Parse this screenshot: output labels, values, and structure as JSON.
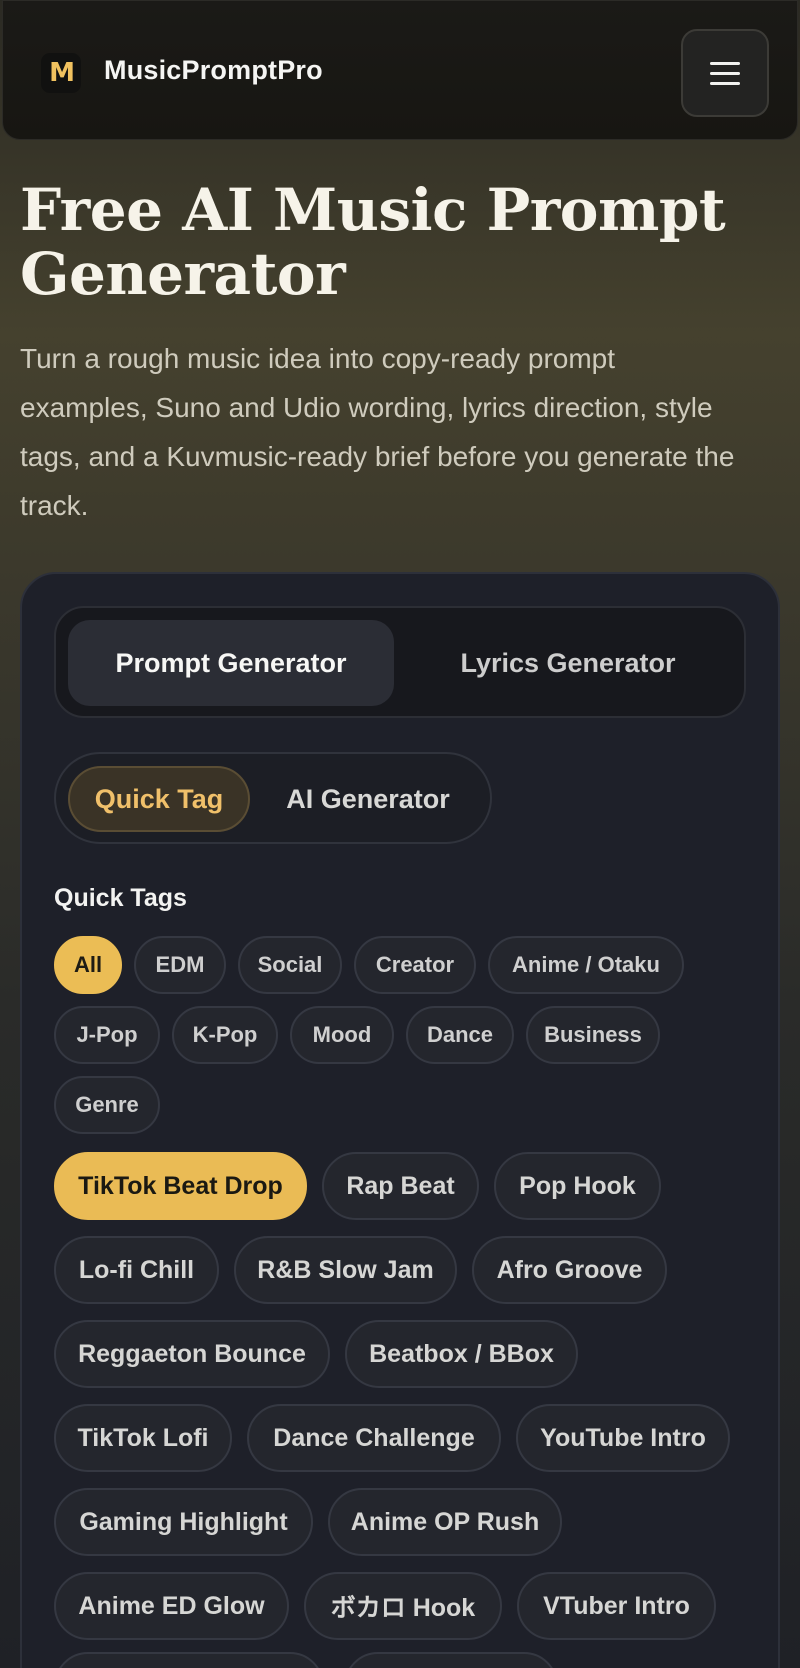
{
  "header": {
    "logo_text": "M",
    "brand": "MusicPromptPro",
    "menu_icon": "hamburger-icon"
  },
  "hero": {
    "title": "Free AI Music Prompt Generator",
    "subtitle": "Turn a rough music idea into copy-ready prompt examples, Suno and Udio wording, lyrics direction, style tags, and a Kuvmusic-ready brief before you generate the track."
  },
  "tabs": {
    "active": "Prompt Generator",
    "inactive": "Lyrics Generator"
  },
  "mode": {
    "active": "Quick Tag",
    "inactive": "AI Generator"
  },
  "quick_tags_label": "Quick Tags",
  "categories": [
    "All",
    "EDM",
    "Social",
    "Creator",
    "Anime / Otaku",
    "J-Pop",
    "K-Pop",
    "Mood",
    "Dance",
    "Business",
    "Genre"
  ],
  "selected_category": "All",
  "tags": [
    "TikTok Beat Drop",
    "Rap Beat",
    "Pop Hook",
    "Lo-fi Chill",
    "R&B Slow Jam",
    "Afro Groove",
    "Reggaeton Bounce",
    "Beatbox / BBox",
    "TikTok Lofi",
    "Dance Challenge",
    "YouTube Intro",
    "Gaming Highlight",
    "Anime OP Rush",
    "Anime ED Glow",
    "ボカロ Hook",
    "VTuber Intro"
  ],
  "selected_tag": "TikTok Beat Drop",
  "colors": {
    "accent": "#EBBD55",
    "card_bg": "#1E2029",
    "chip_bg": "#24262D"
  }
}
